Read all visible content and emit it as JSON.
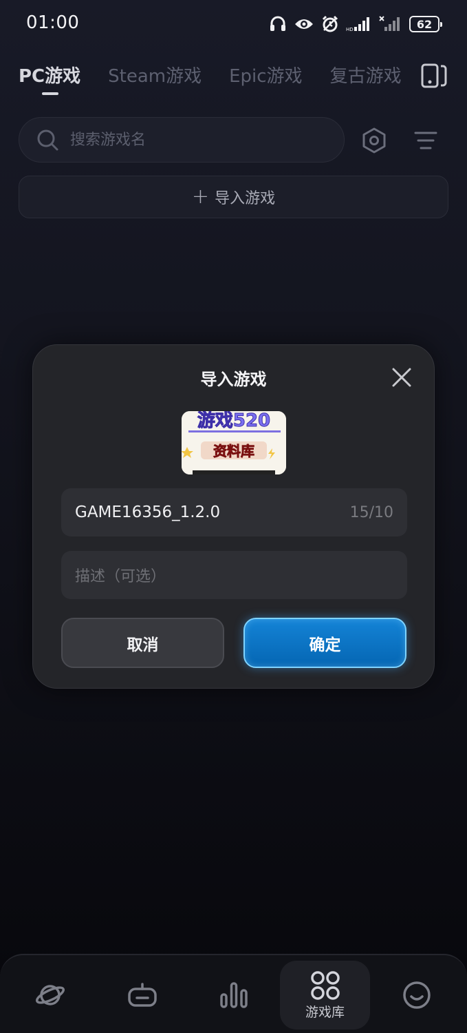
{
  "status_bar": {
    "time": "01:00",
    "battery": "62",
    "icons": [
      "headphones-icon",
      "eye-icon",
      "alarm-icon",
      "signal-icon",
      "signal-x-icon",
      "battery-icon"
    ]
  },
  "tabs": [
    {
      "label": "PC游戏",
      "active": true
    },
    {
      "label": "Steam游戏",
      "active": false
    },
    {
      "label": "Epic游戏",
      "active": false
    },
    {
      "label": "复古游戏",
      "active": false
    }
  ],
  "search": {
    "placeholder": "搜索游戏名"
  },
  "import_bar": {
    "label": "导入游戏"
  },
  "dialog": {
    "title": "导入游戏",
    "name_value": "GAME16356_1.2.0",
    "name_counter": "15/10",
    "desc_placeholder": "描述（可选）",
    "cancel_label": "取消",
    "confirm_label": "确定",
    "thumbnail_text": "游戏520 资料库"
  },
  "bottom_nav": {
    "items": [
      {
        "icon": "planet-icon",
        "label": ""
      },
      {
        "icon": "gamepad-icon",
        "label": ""
      },
      {
        "icon": "bar-chart-icon",
        "label": ""
      },
      {
        "icon": "grid-icon",
        "label": "游戏库",
        "active": true
      },
      {
        "icon": "smiley-icon",
        "label": ""
      }
    ]
  },
  "colors": {
    "accent": "#0a72c4",
    "accent_border": "#7fd3ff",
    "background": "#12131c",
    "dialog_bg": "#242529"
  }
}
